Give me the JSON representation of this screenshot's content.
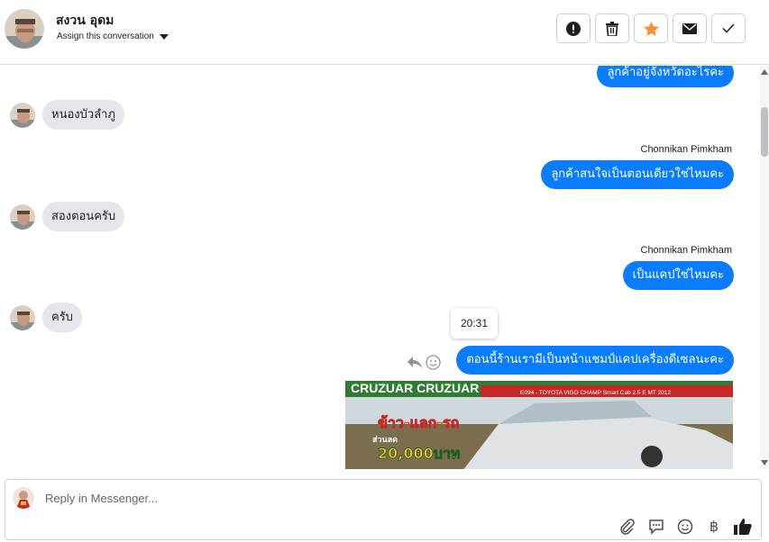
{
  "header": {
    "contact_name": "สงวน อุดม",
    "assign_label": "Assign this conversation",
    "actions": [
      {
        "name": "spam-button",
        "icon": "exclamation-icon"
      },
      {
        "name": "delete-button",
        "icon": "trash-icon"
      },
      {
        "name": "star-button",
        "icon": "star-icon",
        "color": "#f7923b"
      },
      {
        "name": "mark-unread-button",
        "icon": "envelope-icon"
      },
      {
        "name": "mark-done-button",
        "icon": "check-icon"
      }
    ]
  },
  "messages": {
    "out_1": "ลูกค้าอยู่จังหวัดอะไรคะ",
    "in_1": "หนองบัวลำภู",
    "sender_1": "Chonnikan Pimkham",
    "out_2": "ลูกค้าสนใจเป็นตอนเดียวใช่ไหมคะ",
    "in_2": "สองตอนครับ",
    "sender_2": "Chonnikan Pimkham",
    "out_3": "เป็นแคปใช่ไหมคะ",
    "in_3": "ครับ",
    "tooltip_time": "20:31",
    "out_4": "ตอนนี้ร้านเรามีเป็นหน้าแชมป์แคปเครื่องดีเซลนะคะ",
    "image": {
      "top_text": "CRUZUAR CRUZUAR",
      "spec_text": "E094 - TOYOTA VIGO CHAMP Smart Cab 2.5 E MT 2012",
      "promo_line_1": "ข้าว-แลก-รถ",
      "promo_line_2": "ส่วนลด",
      "promo_amount": "20,000บาท"
    }
  },
  "composer": {
    "placeholder": "Reply in Messenger...",
    "tools": [
      "attach-icon",
      "saved-reply-icon",
      "emoji-icon",
      "baht-icon",
      "thumbs-up-icon"
    ],
    "baht_symbol": "฿"
  },
  "colors": {
    "accent": "#0a7cff",
    "incoming_bubble": "#e4e6eb",
    "star": "#f7923b"
  }
}
